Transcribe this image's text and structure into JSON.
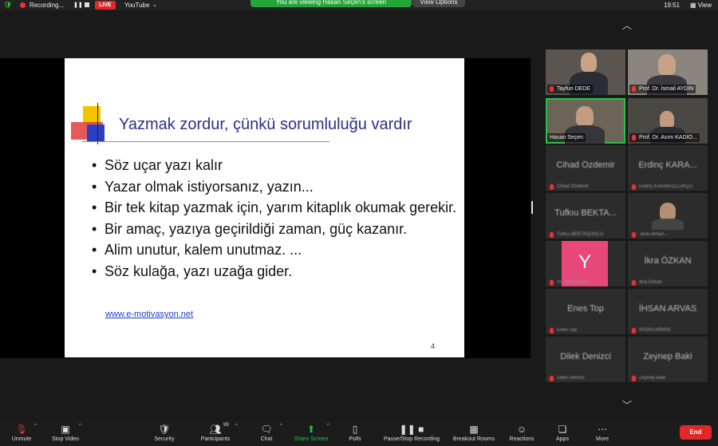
{
  "status_bar": {
    "recording_label": "Recording...",
    "live_label": "LIVE",
    "stream_target": "YouTube",
    "viewing_banner": "You are viewing Hasan Seçen's screen",
    "view_options_label": "View Options",
    "clock": "19:51",
    "view_label": "View"
  },
  "slide": {
    "title": "Yazmak zordur, çünkü  sorumluluğu vardır",
    "bullets": [
      "Söz uçar yazı kalır",
      "Yazar olmak istiyorsanız, yazın...",
      "Bir tek kitap yazmak için, yarım kitaplık okumak gerekir.",
      "Bir amaç, yazıya geçirildiği zaman, güç kazanır.",
      "Alim unutur, kalem unutmaz. ...",
      "Söz kulağa, yazı uzağa gider."
    ],
    "link": "www.e-motivasyon.net",
    "page_number": "4"
  },
  "participants": {
    "video": [
      {
        "name": "Tayfun DEDE"
      },
      {
        "name": "Prof. Dr. İsmail AYDIN"
      },
      {
        "name": "Hasan Seçen"
      },
      {
        "name": "Prof. Dr. Asım KADIO..."
      }
    ],
    "placeholder": [
      {
        "big": "Cihad Özdemir",
        "small": "Cihad Özdemir"
      },
      {
        "big": "Erdinç KARA...",
        "small": "Erdinç KARAKULLUKÇU"
      },
      {
        "big": "Tufkıu BEKTA...",
        "small": "Tufkıu BEKTAŞOĞLU"
      },
      {
        "big": "",
        "small": "Tarık Akhan..."
      },
      {
        "big": "Y",
        "small": "Yt. Tarık Akyüz"
      },
      {
        "big": "İkra ÖZKAN",
        "small": "İkra Özkan"
      },
      {
        "big": "Enes Top",
        "small": "Enes Top"
      },
      {
        "big": "İHSAN ARVAS",
        "small": "İHSAN ARVAS"
      },
      {
        "big": "Dilek Denizci",
        "small": "Dilek Denizci"
      },
      {
        "big": "Zeynep Baki",
        "small": "Zeynep Baki"
      }
    ]
  },
  "toolbar": {
    "unmute": "Unmute",
    "stop_video": "Stop Video",
    "security": "Security",
    "participants": "Participants",
    "participants_count": "99",
    "chat": "Chat",
    "share_screen": "Share Screen",
    "polls": "Polls",
    "recording": "Pause/Stop Recording",
    "breakout": "Breakout Rooms",
    "reactions": "Reactions",
    "apps": "Apps",
    "more": "More",
    "end": "End"
  },
  "colors": {
    "live_red": "#e02828",
    "share_green": "#24c24a",
    "slide_title": "#2e2e8c",
    "link_blue": "#1a3cc8"
  }
}
